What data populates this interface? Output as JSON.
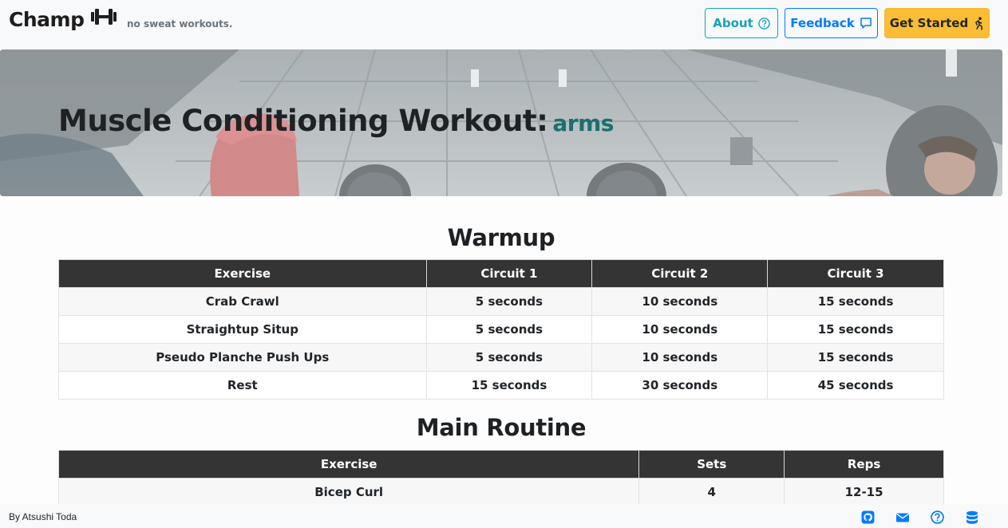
{
  "navbar": {
    "brand": "Champ",
    "tagline": "no sweat workouts.",
    "about_label": "About",
    "feedback_label": "Feedback",
    "start_label": "Get Started"
  },
  "hero": {
    "title": "Muscle Conditioning Workout:",
    "category": "arms"
  },
  "warmup": {
    "title": "Warmup",
    "headers": [
      "Exercise",
      "Circuit 1",
      "Circuit 2",
      "Circuit 3"
    ],
    "rows": [
      [
        "Crab Crawl",
        "5 seconds",
        "10 seconds",
        "15 seconds"
      ],
      [
        "Straightup Situp",
        "5 seconds",
        "10 seconds",
        "15 seconds"
      ],
      [
        "Pseudo Planche Push Ups",
        "5 seconds",
        "10 seconds",
        "15 seconds"
      ],
      [
        "Rest",
        "15 seconds",
        "30 seconds",
        "45 seconds"
      ]
    ]
  },
  "main_routine": {
    "title": "Main Routine",
    "headers": [
      "Exercise",
      "Sets",
      "Reps"
    ],
    "rows": [
      [
        "Bicep Curl",
        "4",
        "12-15"
      ]
    ]
  },
  "footer": {
    "author": "By Atsushi Toda",
    "icons": [
      "github-icon",
      "mail-icon",
      "help-icon",
      "database-icon"
    ]
  },
  "colors": {
    "about": "#17a2b8",
    "feedback": "#007bff",
    "start": "#fbbd33",
    "table_header": "#343434",
    "category": "#1a6f6f"
  }
}
